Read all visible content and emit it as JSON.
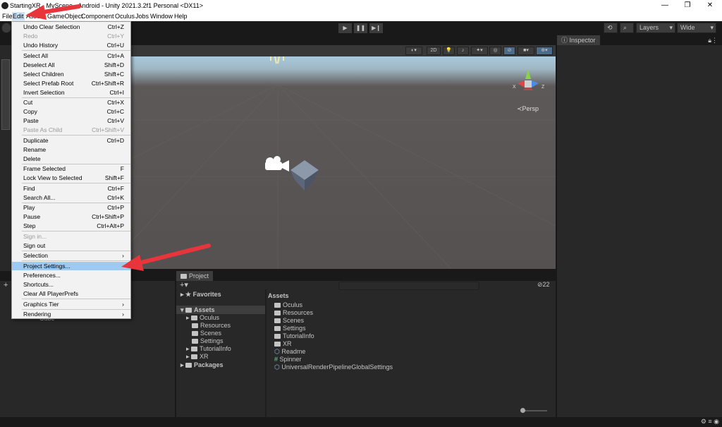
{
  "window": {
    "title": "StartingXR - MyScene - Android - Unity 2021.3.2f1 Personal <DX11>",
    "controls": [
      "—",
      "❐",
      "✕"
    ]
  },
  "menubar": {
    "items": [
      "File",
      "Edit",
      "Assets",
      "GameObject",
      "Component",
      "Oculus",
      "Jobs",
      "Window",
      "Help"
    ]
  },
  "toolbar": {
    "layers_label": "Layers",
    "layout_label": "Wide"
  },
  "scene": {
    "btn_2d": "2D",
    "persp_label": "Persp",
    "axis_x": "X",
    "axis_z": "Z"
  },
  "inspector": {
    "tab_label": "Inspector"
  },
  "project": {
    "tab_label": "Project",
    "favorites_label": "Favorites",
    "assets_label": "Assets",
    "packages_label": "Packages",
    "tree": [
      "Oculus",
      "Resources",
      "Scenes",
      "Settings",
      "TutorialInfo",
      "XR"
    ],
    "breadcrumb": "Assets",
    "files": [
      "Oculus",
      "Resources",
      "Scenes",
      "Settings",
      "TutorialInfo",
      "XR",
      "Readme",
      "Spinner",
      "UniversalRenderPipelineGlobalSettings"
    ],
    "hidden_count": "22"
  },
  "hierarchy": {
    "partial_item": "Cube"
  },
  "edit_menu": {
    "items": [
      {
        "label": "Undo Clear Selection",
        "shortcut": "Ctrl+Z"
      },
      {
        "label": "Redo",
        "shortcut": "Ctrl+Y"
      },
      {
        "label": "Undo History",
        "shortcut": "Ctrl+U"
      },
      {
        "label": "Select All",
        "shortcut": "Ctrl+A"
      },
      {
        "label": "Deselect All",
        "shortcut": "Shift+D"
      },
      {
        "label": "Select Children",
        "shortcut": "Shift+C"
      },
      {
        "label": "Select Prefab Root",
        "shortcut": "Ctrl+Shift+R"
      },
      {
        "label": "Invert Selection",
        "shortcut": "Ctrl+I"
      },
      {
        "label": "Cut",
        "shortcut": "Ctrl+X"
      },
      {
        "label": "Copy",
        "shortcut": "Ctrl+C"
      },
      {
        "label": "Paste",
        "shortcut": "Ctrl+V"
      },
      {
        "label": "Paste As Child",
        "shortcut": "Ctrl+Shift+V"
      },
      {
        "label": "Duplicate",
        "shortcut": "Ctrl+D"
      },
      {
        "label": "Rename",
        "shortcut": ""
      },
      {
        "label": "Delete",
        "shortcut": ""
      },
      {
        "label": "Frame Selected",
        "shortcut": "F"
      },
      {
        "label": "Lock View to Selected",
        "shortcut": "Shift+F"
      },
      {
        "label": "Find",
        "shortcut": "Ctrl+F"
      },
      {
        "label": "Search All...",
        "shortcut": "Ctrl+K"
      },
      {
        "label": "Play",
        "shortcut": "Ctrl+P"
      },
      {
        "label": "Pause",
        "shortcut": "Ctrl+Shift+P"
      },
      {
        "label": "Step",
        "shortcut": "Ctrl+Alt+P"
      },
      {
        "label": "Sign in...",
        "shortcut": ""
      },
      {
        "label": "Sign out",
        "shortcut": ""
      },
      {
        "label": "Selection",
        "shortcut": "›"
      },
      {
        "label": "Project Settings...",
        "shortcut": ""
      },
      {
        "label": "Preferences...",
        "shortcut": ""
      },
      {
        "label": "Shortcuts...",
        "shortcut": ""
      },
      {
        "label": "Clear All PlayerPrefs",
        "shortcut": ""
      },
      {
        "label": "Graphics Tier",
        "shortcut": "›"
      },
      {
        "label": "Rendering",
        "shortcut": "›"
      }
    ]
  },
  "colors": {
    "highlight": "#9ccaf2",
    "annotation_arrow": "#e8353b"
  }
}
